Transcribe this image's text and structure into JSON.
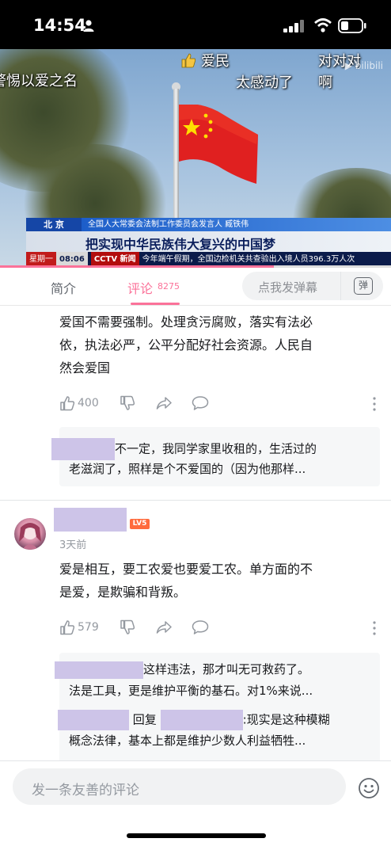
{
  "status_bar": {
    "time": "14:54",
    "icons": [
      "person-icon",
      "signal-icon",
      "wifi-icon",
      "battery-icon"
    ]
  },
  "video": {
    "danmaku": [
      "警惕以爱之名",
      "爱民",
      "太感动了",
      "对对对",
      "啊"
    ],
    "news": {
      "city": "北 京",
      "speaker": "全国人大常委会法制工作委员会发言人 臧铁伟",
      "headline": "把实现中华民族伟大复兴的中国梦",
      "day": "星期一",
      "clock": "08:06",
      "channel_logo": "CCTV 新闻",
      "ticker": "今年端午假期，全国边检机关共查验出入境人员396.3万人次"
    },
    "progress_percent": 70
  },
  "tabs": {
    "intro": "简介",
    "comments": "评论",
    "comment_count": "8275",
    "danmaku_placeholder": "点我发弹幕",
    "danmaku_toggle": "弹"
  },
  "comments": {
    "first": {
      "text_lines": [
        "爱国不需要强制。处理贪污腐败，落实有法必",
        "依，执法必严，公平分配好社会资源。人民自",
        "然会爱国"
      ],
      "likes": "400",
      "replies": [
        "不一定，我同学家里收租的，生活过的",
        "老滋润了，照样是个不爱国的（因为他那样..."
      ]
    },
    "second": {
      "level": "LV5",
      "time": "3天前",
      "text_lines": [
        "爱是相互，要工农爱也要爱工农。单方面的不",
        "是爱，是欺骗和背叛。"
      ],
      "likes": "579",
      "replies": [
        "这样违法，那才叫无可救药了。",
        "法是工具，更是维护平衡的基石。对1%来说...",
        "回复",
        ":现实是这种模糊",
        "概念法律，基本上都是维护少数人利益牺牲..."
      ]
    }
  },
  "bottom": {
    "comment_placeholder": "发一条友善的评论"
  },
  "colors": {
    "accent": "#fb7299",
    "muted": "#9499a0",
    "redaction": "#cdc4e8"
  }
}
